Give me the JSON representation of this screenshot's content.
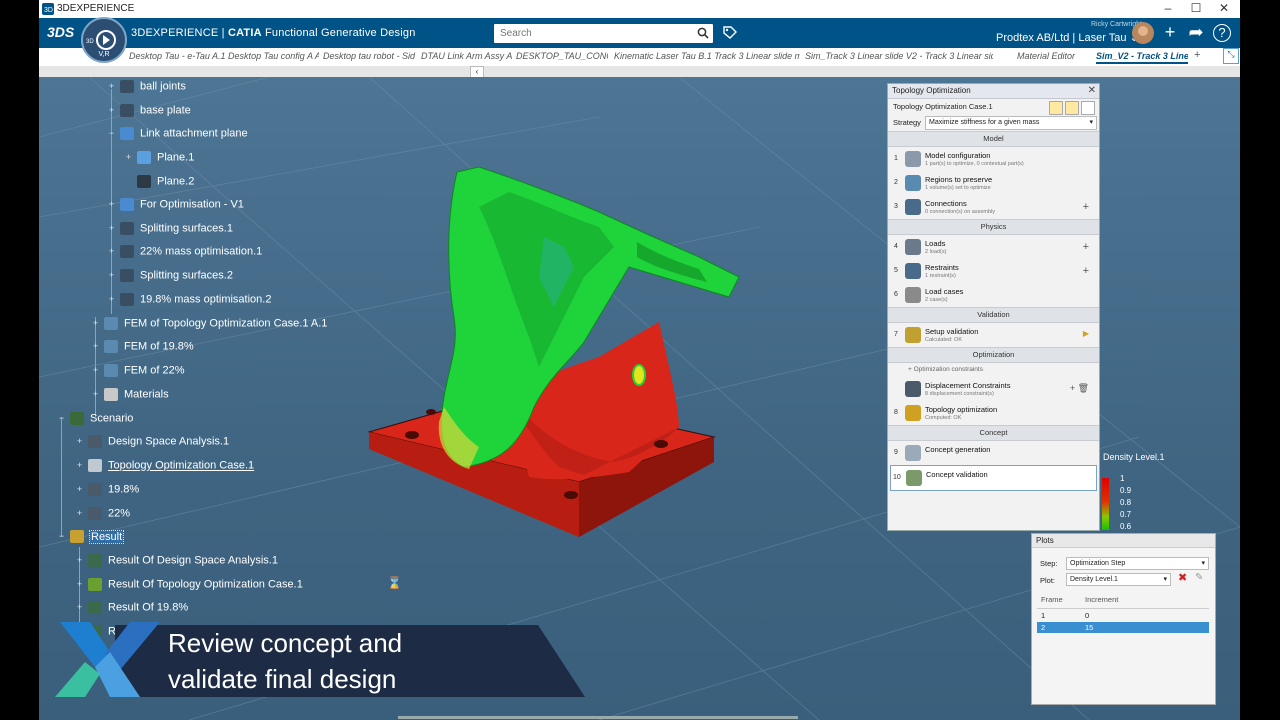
{
  "window": {
    "title": "3DEXPERIENCE",
    "minimize": "–",
    "maximize": "☐",
    "close": "✕"
  },
  "header": {
    "brand_mark": "3DS",
    "compass_label": "V,R",
    "compass_3d": "3D",
    "product_prefix": "3DEXPERIENCE",
    "product_sep": " | ",
    "product_name": "CATIA",
    "app_name": "Functional Generative Design",
    "search_placeholder": "Search",
    "user_name": "Ricky Cartwright",
    "tenant": "Prodtex AB/Ltd | Laser Tau ⌄",
    "add_icon": "+",
    "share_icon": "➦",
    "help_icon": "?"
  },
  "tabs": [
    {
      "label": "Desktop Tau - e-Tau A.1 Desktop Tau config A A",
      "active": false
    },
    {
      "label": "Desktop tau robot - Sid",
      "active": false
    },
    {
      "label": "DTAU Link Arm Assy A",
      "active": false
    },
    {
      "label": "DESKTOP_TAU_CONCE",
      "active": false
    },
    {
      "label": "Kinematic Laser Tau B.1 Track 3 Linear slide mo",
      "active": false
    },
    {
      "label": "Sim_Track 3 Linear slide V2 - Track 3 Linear sid",
      "active": false
    },
    {
      "label": "Material Editor",
      "active": false
    },
    {
      "label": "Sim_V2 - Track 3 Linea",
      "active": true
    }
  ],
  "tab_add": "+",
  "collapse_label": "‹",
  "tree": {
    "items": [
      {
        "label": "ball joints",
        "level": 4,
        "expander": "+",
        "icon_color": "#3a4e63"
      },
      {
        "label": "base plate",
        "level": 4,
        "expander": "+",
        "icon_color": "#3a4e63"
      },
      {
        "label": "Link attachment plane",
        "level": 4,
        "expander": "−",
        "icon_color": "#4a8ad0"
      },
      {
        "label": "Plane.1",
        "level": 5,
        "expander": "+",
        "icon_color": "#5aa0e0"
      },
      {
        "label": "Plane.2",
        "level": 5,
        "expander": "",
        "icon_color": "#2d3a46"
      },
      {
        "label": "For Optimisation - V1",
        "level": 4,
        "expander": "+",
        "icon_color": "#4a8ad0"
      },
      {
        "label": "Splitting surfaces.1",
        "level": 4,
        "expander": "+",
        "icon_color": "#3a4e63"
      },
      {
        "label": "22% mass optimisation.1",
        "level": 4,
        "expander": "+",
        "icon_color": "#3a4e63"
      },
      {
        "label": "Splitting surfaces.2",
        "level": 4,
        "expander": "+",
        "icon_color": "#3a4e63"
      },
      {
        "label": "19.8% mass optimisation.2",
        "level": 4,
        "expander": "+",
        "icon_color": "#3a4e63"
      },
      {
        "label": "FEM of Topology Optimization Case.1 A.1",
        "level": 3,
        "expander": "+",
        "icon_color": "#5a8ab0"
      },
      {
        "label": "FEM of 19.8%",
        "level": 3,
        "expander": "+",
        "icon_color": "#5a8ab0"
      },
      {
        "label": "FEM of 22%",
        "level": 3,
        "expander": "+",
        "icon_color": "#5a8ab0"
      },
      {
        "label": "Materials",
        "level": 3,
        "expander": "+",
        "icon_color": "#c8c8c8"
      },
      {
        "label": "Scenario",
        "level": 1,
        "expander": "−",
        "icon_color": "#3a6a3a"
      },
      {
        "label": "Design Space Analysis.1",
        "level": 2,
        "expander": "+",
        "icon_color": "#4a5a6a"
      },
      {
        "label": "Topology Optimization Case.1",
        "level": 2,
        "expander": "+",
        "icon_color": "#c0c8d0",
        "underline": true
      },
      {
        "label": "19.8%",
        "level": 2,
        "expander": "+",
        "icon_color": "#4a5a6a"
      },
      {
        "label": "22%",
        "level": 2,
        "expander": "+",
        "icon_color": "#4a5a6a"
      },
      {
        "label": "Result",
        "level": 1,
        "expander": "−",
        "icon_color": "#c8a030",
        "selected": true
      },
      {
        "label": "Result Of Design Space Analysis.1",
        "level": 2,
        "expander": "+",
        "icon_color": "#3a6a4a"
      },
      {
        "label": "Result Of Topology Optimization Case.1",
        "level": 2,
        "expander": "+",
        "icon_color": "#6aa030"
      },
      {
        "label": "Result Of 19.8%",
        "level": 2,
        "expander": "+",
        "icon_color": "#3a6a4a"
      },
      {
        "label": "Result O",
        "level": 2,
        "expander": "+",
        "icon_color": "#3a6a4a"
      }
    ]
  },
  "topology_panel": {
    "title": "Topology Optimization",
    "close": "✕",
    "case_name": "Topology Optimization Case.1",
    "strategy_label": "Strategy",
    "strategy_value": "Maximize stiffness for a given mass",
    "sections": [
      {
        "title": "Model",
        "steps": [
          {
            "num": "1",
            "title": "Model configuration",
            "sub": "1 part(s) to optimize, 0 contextual part(s)",
            "plus": "",
            "icon_color": "#8a9aaa"
          },
          {
            "num": "2",
            "title": "Regions to preserve",
            "sub": "1 volume(s) set to optimize",
            "plus": "",
            "icon_color": "#5a8ab0"
          },
          {
            "num": "3",
            "title": "Connections",
            "sub": "0 connection(s) on assembly",
            "plus": "+",
            "icon_color": "#4a6a8a"
          }
        ]
      },
      {
        "title": "Physics",
        "steps": [
          {
            "num": "4",
            "title": "Loads",
            "sub": "2 load(s)",
            "plus": "+",
            "icon_color": "#6a7a8a"
          },
          {
            "num": "5",
            "title": "Restraints",
            "sub": "1 restraint(s)",
            "plus": "+",
            "icon_color": "#4a6a8a"
          },
          {
            "num": "6",
            "title": "Load cases",
            "sub": "2 case(s)",
            "plus": "",
            "icon_color": "#8a8a8a"
          }
        ]
      },
      {
        "title": "Validation",
        "steps": [
          {
            "num": "7",
            "title": "Setup validation",
            "sub": "Calculated: OK",
            "plus": "▶",
            "icon_color": "#c0a030"
          }
        ]
      },
      {
        "title": "Optimization",
        "pre": "Optimization constraints",
        "steps": [
          {
            "num": "",
            "title": "Displacement Constraints",
            "sub": "8 displacement constraint(s)",
            "plus": "+  🗑",
            "icon_color": "#4a5a6a"
          },
          {
            "num": "8",
            "title": "Topology optimization",
            "sub": "Computed: OK",
            "plus": "",
            "icon_color": "#d0a020"
          }
        ]
      },
      {
        "title": "Concept",
        "steps": [
          {
            "num": "9",
            "title": "Concept generation",
            "sub": "",
            "plus": "",
            "icon_color": "#9aaab8"
          },
          {
            "num": "10",
            "title": "Concept validation",
            "sub": "",
            "plus": "",
            "icon_color": "#7a9a6a",
            "boxed": true
          }
        ]
      }
    ]
  },
  "density": {
    "title": "Density Level.1",
    "ticks": [
      "1",
      "0.9",
      "0.8",
      "0.7",
      "0.6"
    ]
  },
  "plots_panel": {
    "title": "Plots",
    "step_label": "Step:",
    "step_value": "Optimization Step",
    "plot_label": "Plot:",
    "plot_value": "Density Level.1",
    "columns": [
      "Frame",
      "Increment"
    ],
    "rows": [
      [
        "1",
        "0"
      ],
      [
        "2",
        "15"
      ]
    ],
    "selected_row": 1
  },
  "banner": {
    "line1": "Review concept and",
    "line2": "validate final design"
  },
  "colors": {
    "header_bg": "#005386",
    "viewport_bg": "#446b8a",
    "part_green": "#1fd43a",
    "part_red": "#dc2418",
    "banner_bg": "#1d2b44"
  }
}
